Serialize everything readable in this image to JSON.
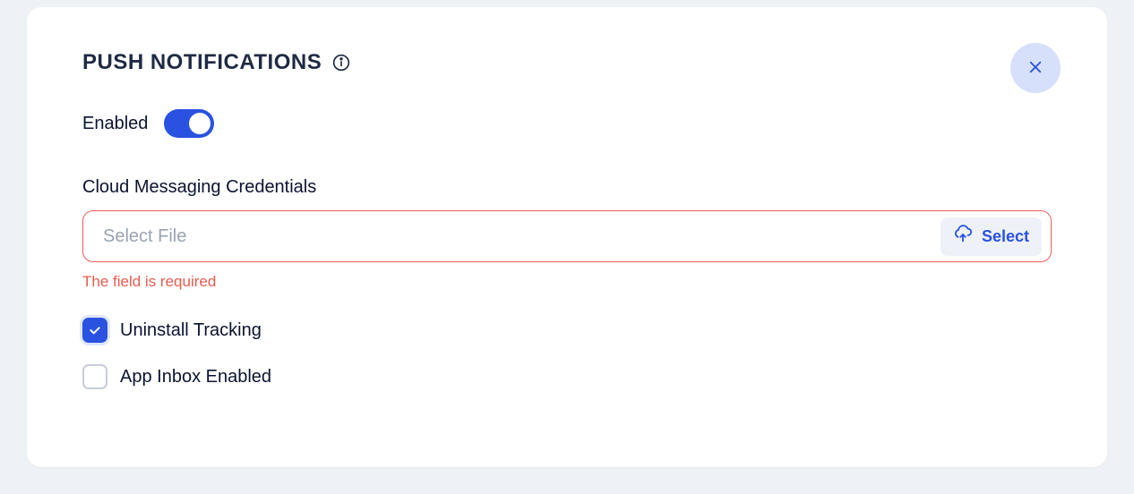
{
  "section": {
    "title": "PUSH NOTIFICATIONS",
    "enabled_label": "Enabled",
    "credentials_label": "Cloud Messaging Credentials",
    "file_placeholder": "Select File",
    "select_button": "Select",
    "error_message": "The field is required",
    "uninstall_tracking_label": "Uninstall Tracking",
    "app_inbox_label": "App Inbox Enabled"
  }
}
